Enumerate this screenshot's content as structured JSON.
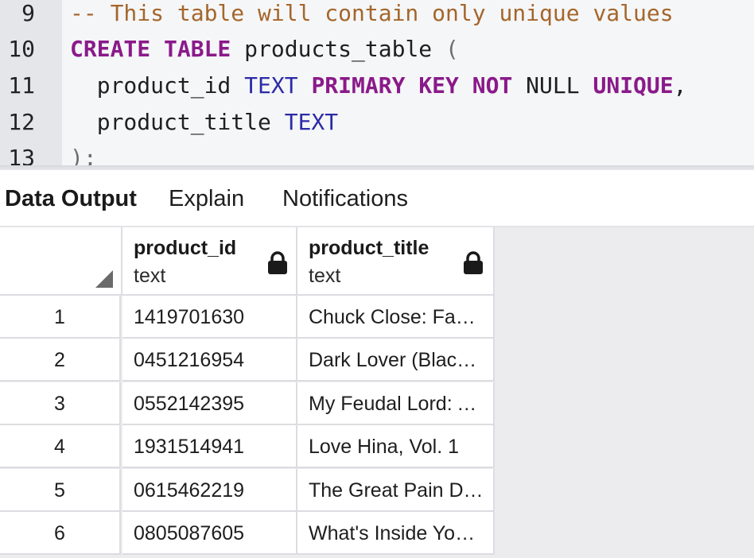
{
  "editor": {
    "lines": [
      {
        "num": "9",
        "tokens": [
          {
            "t": "-- This table will contain only unique values",
            "c": "comment"
          }
        ]
      },
      {
        "num": "10",
        "tokens": [
          {
            "t": "CREATE TABLE",
            "c": "keyword"
          },
          {
            "t": " products_table ",
            "c": "plain"
          },
          {
            "t": "(",
            "c": "punct"
          }
        ]
      },
      {
        "num": "11",
        "tokens": [
          {
            "t": "  product_id ",
            "c": "plain"
          },
          {
            "t": "TEXT",
            "c": "type"
          },
          {
            "t": " ",
            "c": "plain"
          },
          {
            "t": "PRIMARY KEY NOT",
            "c": "keyword"
          },
          {
            "t": " NULL ",
            "c": "plain"
          },
          {
            "t": "UNIQUE",
            "c": "keyword"
          },
          {
            "t": ",",
            "c": "plain"
          }
        ]
      },
      {
        "num": "12",
        "tokens": [
          {
            "t": "  product_title ",
            "c": "plain"
          },
          {
            "t": "TEXT",
            "c": "type"
          }
        ]
      },
      {
        "num": "13",
        "tokens": [
          {
            "t": ");",
            "c": "punct"
          }
        ]
      }
    ]
  },
  "tabs": [
    {
      "label": "Data Output",
      "active": true
    },
    {
      "label": "Explain",
      "active": false
    },
    {
      "label": "Notifications",
      "active": false
    }
  ],
  "grid": {
    "columns": [
      {
        "name": "product_id",
        "type": "text",
        "icon": "lock-icon"
      },
      {
        "name": "product_title",
        "type": "text",
        "icon": "lock-icon"
      }
    ],
    "rows": [
      {
        "num": "1",
        "product_id": "1419701630",
        "product_title": "Chuck Close: Face Book"
      },
      {
        "num": "2",
        "product_id": "0451216954",
        "product_title": "Dark Lover (Black Dagger Brotherhood)"
      },
      {
        "num": "3",
        "product_id": "0552142395",
        "product_title": "My Feudal Lord: A Devastating Indictment"
      },
      {
        "num": "4",
        "product_id": "1931514941",
        "product_title": "Love Hina, Vol. 1"
      },
      {
        "num": "5",
        "product_id": "0615462219",
        "product_title": "The Great Pain Deception"
      },
      {
        "num": "6",
        "product_id": "0805087605",
        "product_title": "What's Inside Your Head"
      }
    ]
  },
  "colors": {
    "comment": "#a4662c",
    "keyword": "#8a1a8a",
    "type": "#2b2ba8"
  }
}
